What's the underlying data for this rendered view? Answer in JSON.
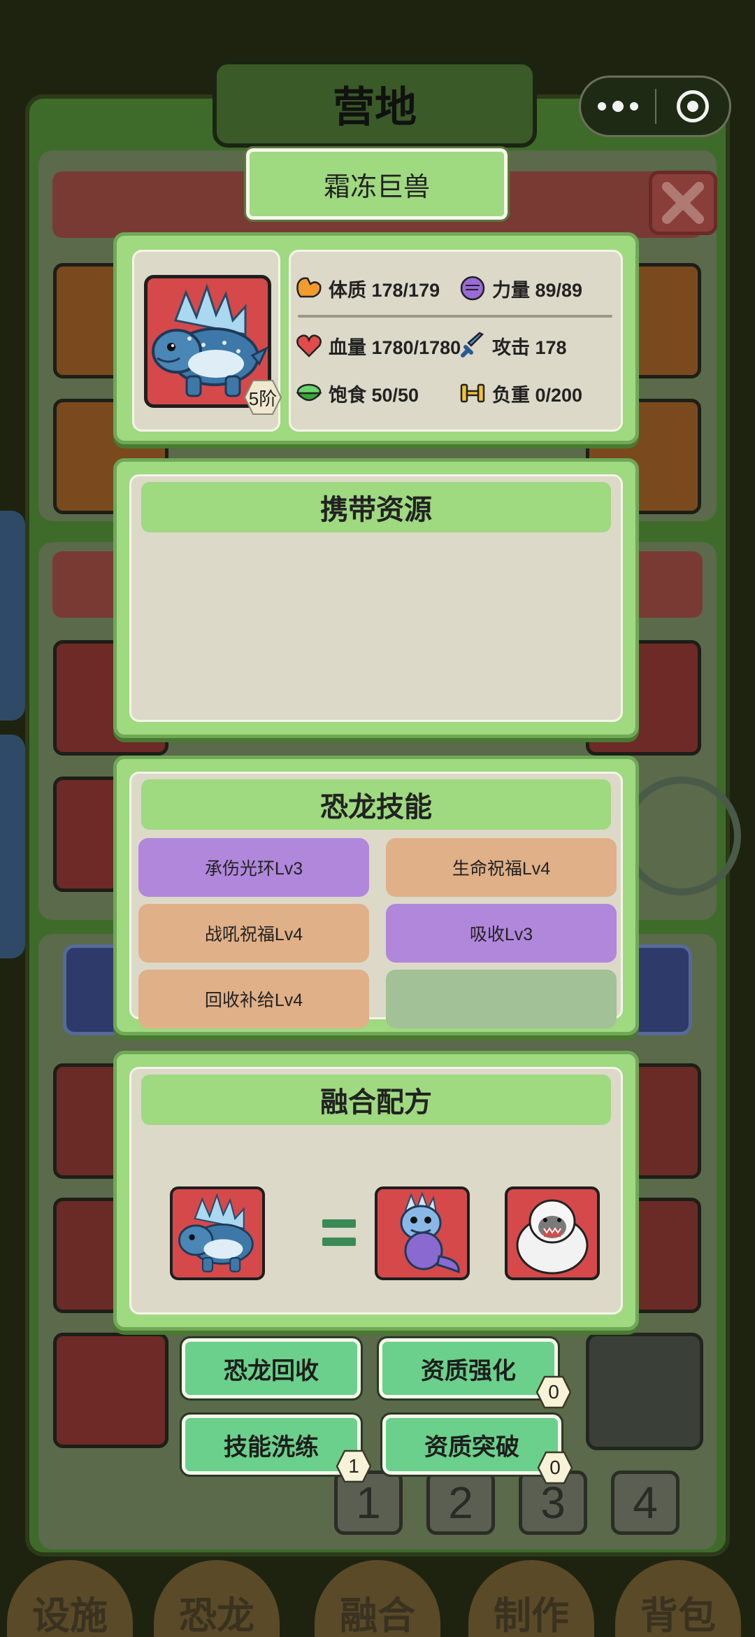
{
  "header": {
    "title": "营地"
  },
  "capsule": {
    "more_icon": "more-dots-icon",
    "close_icon": "target-circle-icon"
  },
  "modal": {
    "dino_name": "霜冻巨兽",
    "grade": "5阶",
    "stats": {
      "constitution": "体质 178/179",
      "strength": "力量 89/89",
      "hp": "血量 1780/1780",
      "attack": "攻击 178",
      "satiety": "饱食 50/50",
      "load": "负重 0/200"
    },
    "resources": {
      "title": "携带资源",
      "items": []
    },
    "skills": {
      "title": "恐龙技能",
      "items": [
        {
          "label": "承伤光环Lv3",
          "color": "#b187dc"
        },
        {
          "label": "生命祝福Lv4",
          "color": "#e0b088"
        },
        {
          "label": "战吼祝福Lv4",
          "color": "#e0b088"
        },
        {
          "label": "吸收Lv3",
          "color": "#b187dc"
        },
        {
          "label": "回收补给Lv4",
          "color": "#e0b088"
        },
        {
          "label": "",
          "color": "#a2c196"
        }
      ]
    },
    "fusion": {
      "title": "融合配方",
      "operator": "="
    }
  },
  "actions": {
    "recycle": "恐龙回收",
    "enhance": "资质强化",
    "enhance_count": "0",
    "reroll": "技能洗练",
    "reroll_count": "1",
    "breakthrough": "资质突破",
    "breakthrough_count": "0"
  },
  "background": {
    "page_numbers": [
      "1",
      "2",
      "3",
      "4"
    ],
    "nav": [
      "设施",
      "恐龙",
      "融合",
      "制作",
      "背包"
    ]
  },
  "colors": {
    "panel_green": "#9fd980",
    "panel_bg": "#dcd9c9",
    "action_green": "#6bd08b",
    "portrait_red": "#d5494b",
    "skill_purple": "#b187dc",
    "skill_orange": "#e0b088"
  }
}
